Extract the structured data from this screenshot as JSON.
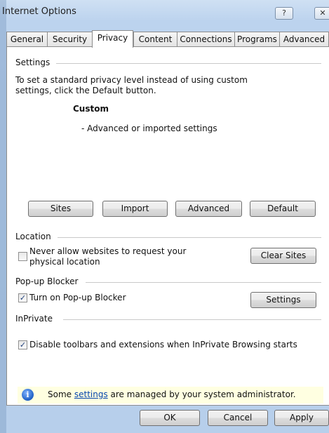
{
  "window": {
    "title": "Internet Options",
    "help_glyph": "?",
    "close_glyph": "✕"
  },
  "tabs": [
    {
      "label": "General"
    },
    {
      "label": "Security"
    },
    {
      "label": "Privacy"
    },
    {
      "label": "Content"
    },
    {
      "label": "Connections"
    },
    {
      "label": "Programs"
    },
    {
      "label": "Advanced"
    }
  ],
  "active_tab": "Privacy",
  "settings": {
    "heading": "Settings",
    "description_line1": "To set a standard privacy level instead of using custom",
    "description_line2": "settings, click the Default button.",
    "level_title": "Custom",
    "level_desc": "- Advanced or imported settings",
    "buttons": {
      "sites": "Sites",
      "import": "Import",
      "advanced": "Advanced",
      "default": "Default"
    }
  },
  "location": {
    "heading": "Location",
    "checkbox_line1": "Never allow websites to request your",
    "checkbox_line2": "physical location",
    "checked": false,
    "clear_sites": "Clear Sites"
  },
  "popup": {
    "heading": "Pop-up Blocker",
    "checkbox_label": "Turn on Pop-up Blocker",
    "checked": true,
    "settings_button": "Settings"
  },
  "inprivate": {
    "heading": "InPrivate",
    "checkbox_label": "Disable toolbars and extensions when InPrivate Browsing starts",
    "checked": true
  },
  "info": {
    "icon_letter": "i",
    "prefix": "Some ",
    "link": "settings",
    "suffix": " are managed by your system administrator."
  },
  "footer": {
    "ok": "OK",
    "cancel": "Cancel",
    "apply": "Apply"
  },
  "check_glyph": "✓"
}
